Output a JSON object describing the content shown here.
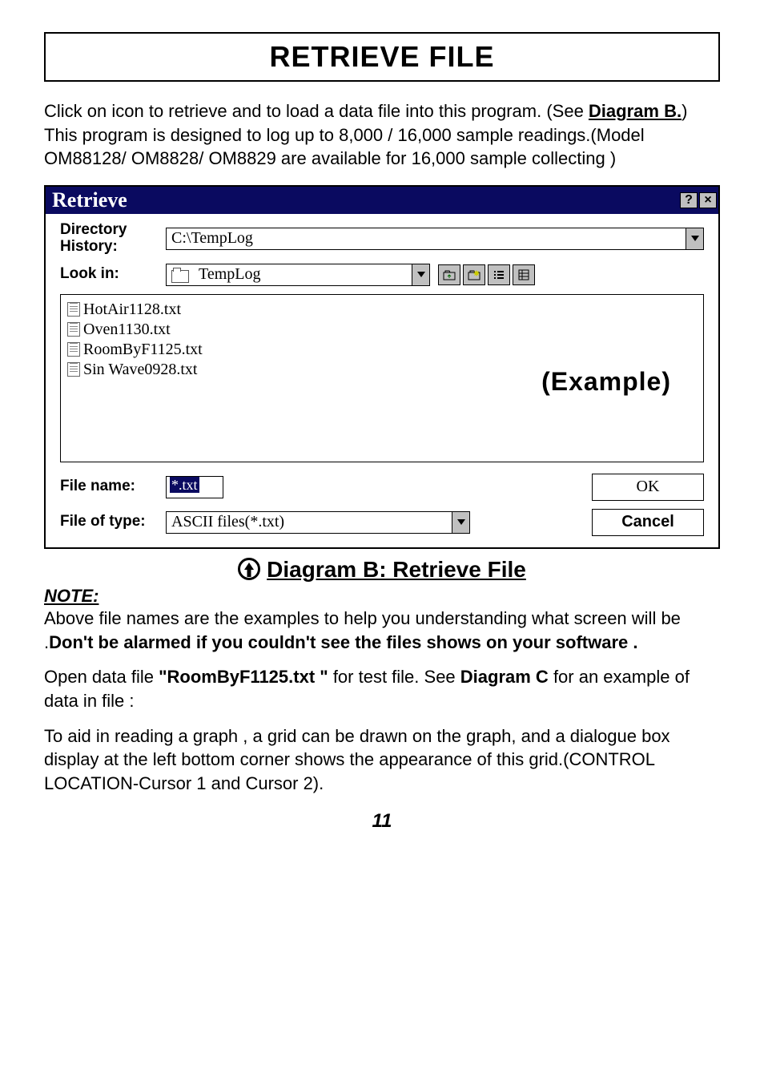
{
  "title": "RETRIEVE  FILE",
  "intro": {
    "line1a": "Click on icon to retrieve and to load a data file into this program. (See ",
    "diagram_ref": "Diagram B.",
    "line1b": ")   This program is designed to log up to 8,000 / 16,000 sample readings.(Model OM88128/ OM8828/ OM8829 are available for 16,000 sample collecting )"
  },
  "dialog": {
    "title": "Retrieve",
    "labels": {
      "dir_history": "Directory History:",
      "look_in": "Look in:",
      "file_name": "File name:",
      "file_type": "File of type:"
    },
    "dir_history_value": "C:\\TempLog",
    "look_in_value": "TempLog",
    "files": [
      "HotAir1128.txt",
      "Oven1130.txt",
      "RoomByF1125.txt",
      "Sin Wave0928.txt"
    ],
    "example_label": "(Example)",
    "file_name_value": "*.txt",
    "file_type_value": "ASCII files(*.txt)",
    "buttons": {
      "ok": "OK",
      "cancel": "Cancel"
    }
  },
  "caption": "Diagram B:  Retrieve File",
  "note": {
    "label": "NOTE:",
    "p1a": "Above file names are the examples to help you understanding what screen will be .",
    "p1b": "Don't be alarmed if you couldn't see the files shows on your software .",
    "p2a": "Open data file ",
    "p2file": "\"RoomByF1125.txt \"",
    "p2b": " for test file. See ",
    "p2diag": "Diagram C",
    "p2c": " for an example of data in file :",
    "p3": "To aid in reading a graph , a grid can be drawn on the graph, and a dialogue box display at the left bottom corner shows the appearance of this grid.(CONTROL LOCATION-Cursor 1 and Cursor 2)."
  },
  "page_number": "11"
}
